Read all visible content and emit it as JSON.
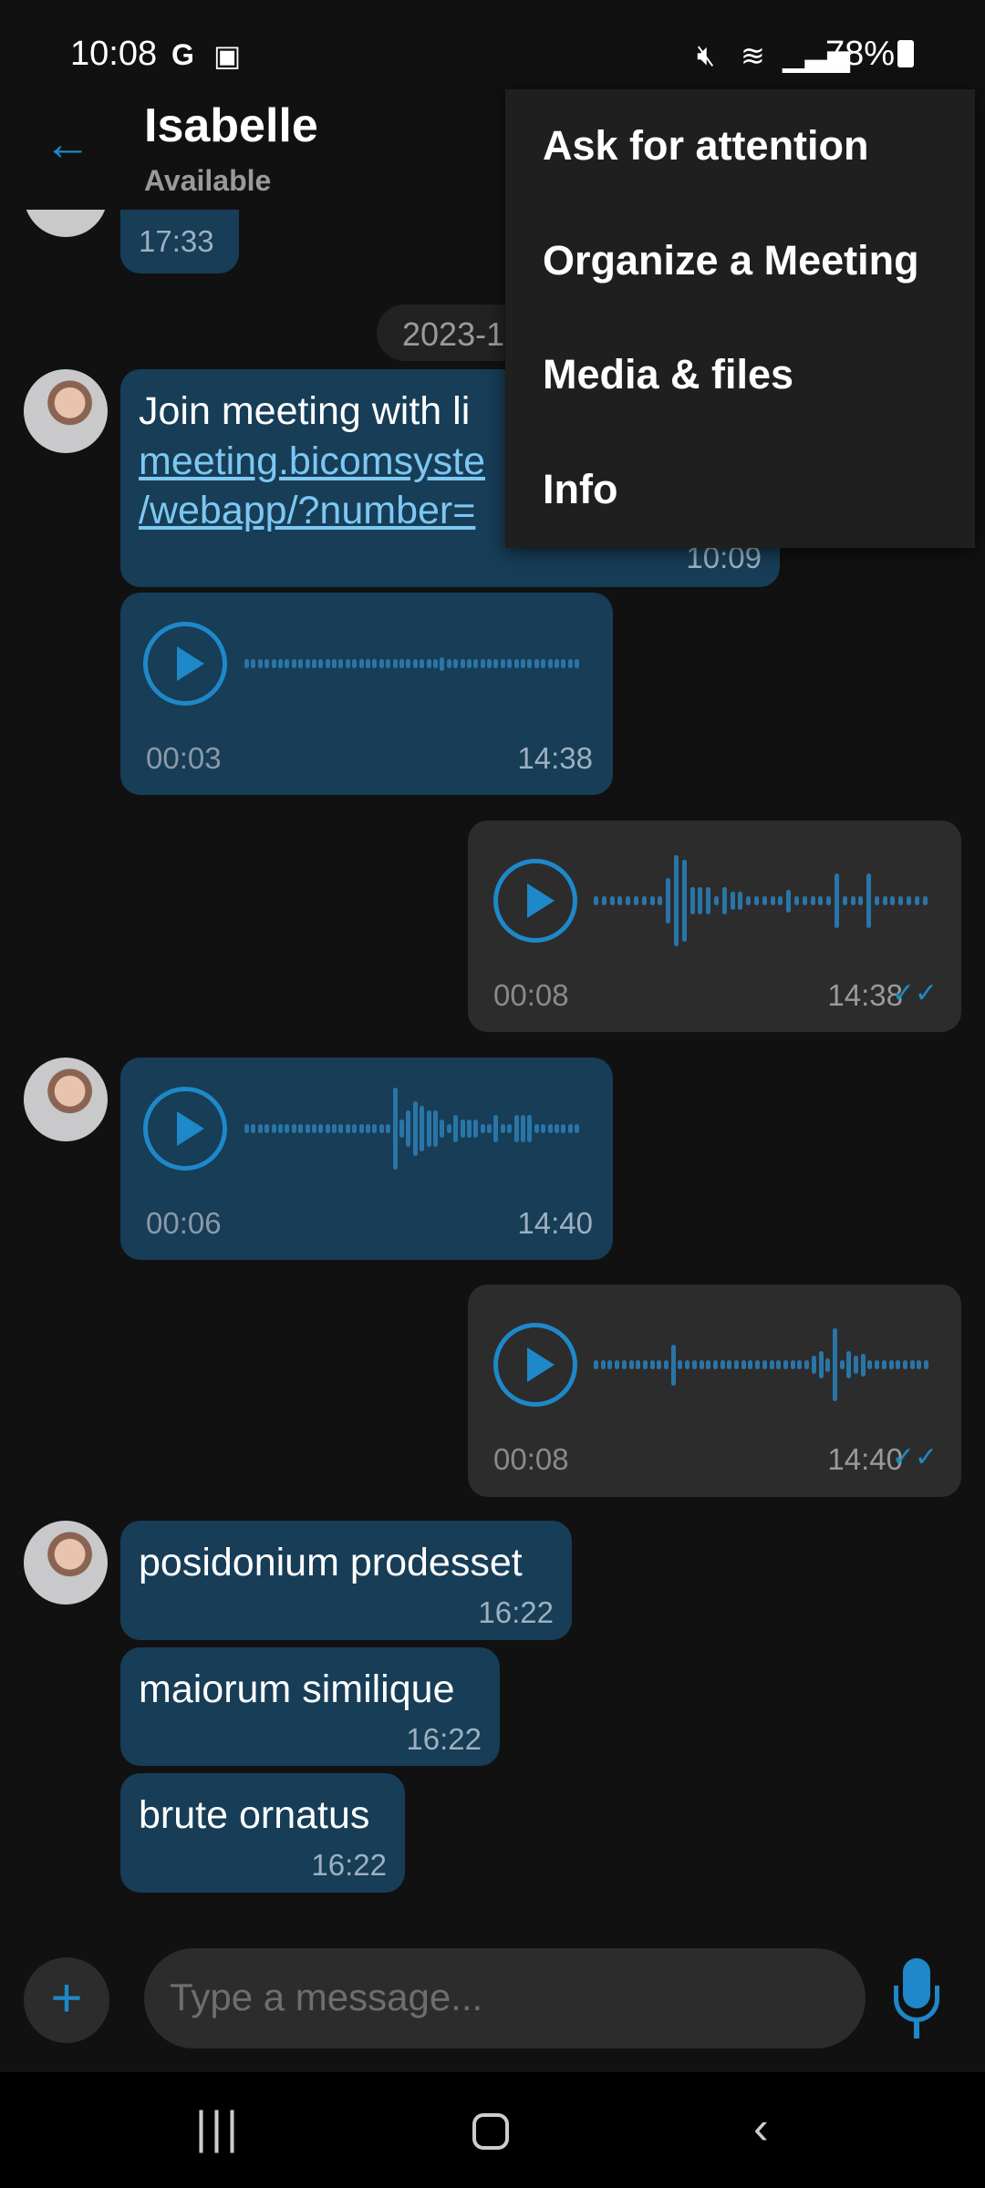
{
  "status_bar": {
    "time": "10:08",
    "battery": "78%",
    "icons": [
      "google-icon",
      "gallery-icon",
      "mute-icon",
      "wifi-icon",
      "signal-icon",
      "battery-icon"
    ]
  },
  "header": {
    "contact_name": "Isabelle",
    "status": "Available",
    "back_icon": "arrow-left-icon"
  },
  "menu": {
    "items": [
      {
        "label": "Ask for attention"
      },
      {
        "label": "Organize a Meeting"
      },
      {
        "label": "Media & files"
      },
      {
        "label": "Info"
      }
    ]
  },
  "messages": {
    "partial": {
      "time": "17:33"
    },
    "date_chip": "2023-1",
    "link_msg": {
      "text": "Join meeting with li",
      "link_line1": "meeting.bicomsyste",
      "link_line2": "/webapp/?number=",
      "time": "10:09"
    },
    "audio_in_1": {
      "duration": "00:03",
      "time": "14:38",
      "waveform": [
        0.1,
        0.1,
        0.1,
        0.1,
        0.1,
        0.1,
        0.1,
        0.1,
        0.1,
        0.1,
        0.1,
        0.1,
        0.1,
        0.1,
        0.1,
        0.1,
        0.1,
        0.1,
        0.1,
        0.1,
        0.1,
        0.1,
        0.1,
        0.1,
        0.1,
        0.1,
        0.1,
        0.1,
        0.1,
        0.15,
        0.1,
        0.1,
        0.1,
        0.1,
        0.1,
        0.1,
        0.1,
        0.1,
        0.1,
        0.1,
        0.1,
        0.1,
        0.1,
        0.1,
        0.1,
        0.1,
        0.1,
        0.1,
        0.1,
        0.1
      ]
    },
    "audio_out_1": {
      "duration": "00:08",
      "time": "14:38",
      "waveform": [
        0.1,
        0.1,
        0.1,
        0.1,
        0.1,
        0.1,
        0.1,
        0.1,
        0.1,
        0.5,
        1,
        0.9,
        0.3,
        0.3,
        0.3,
        0.1,
        0.3,
        0.2,
        0.2,
        0.1,
        0.1,
        0.1,
        0.1,
        0.1,
        0.25,
        0.1,
        0.1,
        0.1,
        0.1,
        0.1,
        0.6,
        0.1,
        0.1,
        0.1,
        0.6,
        0.1,
        0.1,
        0.1,
        0.1,
        0.1,
        0.1,
        0.1
      ]
    },
    "audio_in_2": {
      "duration": "00:06",
      "time": "14:40",
      "waveform": [
        0.1,
        0.1,
        0.1,
        0.1,
        0.1,
        0.1,
        0.1,
        0.1,
        0.1,
        0.1,
        0.1,
        0.1,
        0.1,
        0.1,
        0.1,
        0.1,
        0.1,
        0.1,
        0.1,
        0.1,
        0.1,
        0.1,
        0.9,
        0.2,
        0.4,
        0.6,
        0.5,
        0.4,
        0.4,
        0.2,
        0.1,
        0.3,
        0.2,
        0.2,
        0.2,
        0.1,
        0.1,
        0.3,
        0.1,
        0.1,
        0.3,
        0.3,
        0.3,
        0.1,
        0.1,
        0.1,
        0.1,
        0.1,
        0.1,
        0.1
      ]
    },
    "audio_out_2": {
      "duration": "00:08",
      "time": "14:40",
      "waveform": [
        0.1,
        0.1,
        0.1,
        0.1,
        0.1,
        0.1,
        0.1,
        0.1,
        0.1,
        0.1,
        0.1,
        0.45,
        0.1,
        0.1,
        0.1,
        0.1,
        0.1,
        0.1,
        0.1,
        0.1,
        0.1,
        0.1,
        0.1,
        0.1,
        0.1,
        0.1,
        0.1,
        0.1,
        0.1,
        0.1,
        0.1,
        0.2,
        0.3,
        0.15,
        0.8,
        0.1,
        0.3,
        0.2,
        0.25,
        0.1,
        0.1,
        0.1,
        0.1,
        0.1,
        0.1,
        0.1,
        0.1,
        0.1
      ]
    },
    "text_1": {
      "text": "posidonium prodesset",
      "time": "16:22"
    },
    "text_2": {
      "text": "maiorum similique",
      "time": "16:22"
    },
    "text_3": {
      "text": "brute ornatus",
      "time": "16:22"
    }
  },
  "composer": {
    "placeholder": "Type a message..."
  },
  "colors": {
    "accent": "#1e88c8",
    "incoming_bubble": "#173d57",
    "outgoing_bubble": "#2c2c2c",
    "background": "#111111",
    "link": "#7cc8f2"
  }
}
